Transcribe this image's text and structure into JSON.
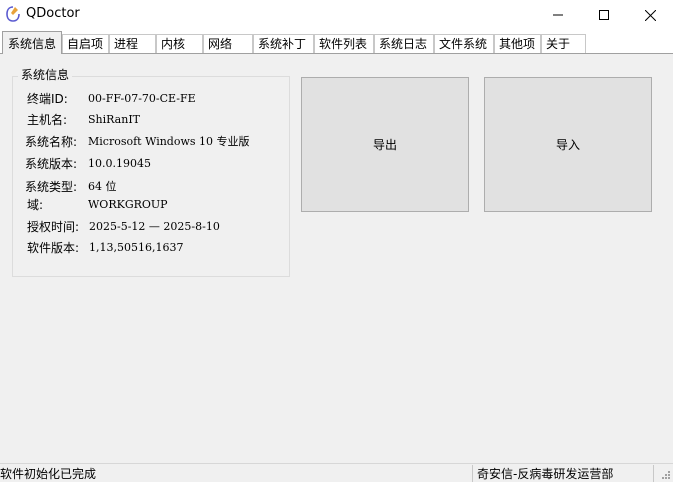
{
  "window": {
    "title": "QDoctor"
  },
  "tabs": [
    {
      "label": "系统信息",
      "active": true
    },
    {
      "label": "自启项"
    },
    {
      "label": "进程"
    },
    {
      "label": "内核"
    },
    {
      "label": "网络"
    },
    {
      "label": "系统补丁"
    },
    {
      "label": "软件列表"
    },
    {
      "label": "系统日志"
    },
    {
      "label": "文件系统"
    },
    {
      "label": "其他项"
    },
    {
      "label": "关于"
    }
  ],
  "sysinfo": {
    "group_title": "系统信息",
    "rows": [
      {
        "label": "终端ID:",
        "value": "00-FF-07-70-CE-FE"
      },
      {
        "label": "主机名:",
        "value": "ShiRanIT"
      },
      {
        "label": "系统名称:",
        "value": "Microsoft Windows 10 专业版"
      },
      {
        "label": "系统版本:",
        "value": "10.0.19045"
      },
      {
        "label": "系统类型:",
        "value": "64 位"
      },
      {
        "label": "域:",
        "value": "WORKGROUP"
      },
      {
        "label": "授权时间:",
        "value": "2025-5-12 — 2025-8-10"
      },
      {
        "label": "软件版本:",
        "value": "1,13,50516,1637"
      }
    ]
  },
  "actions": {
    "export_label": "导出",
    "import_label": "导入"
  },
  "status": {
    "left": "软件初始化已完成",
    "right": "奇安信-反病毒研发运营部"
  }
}
